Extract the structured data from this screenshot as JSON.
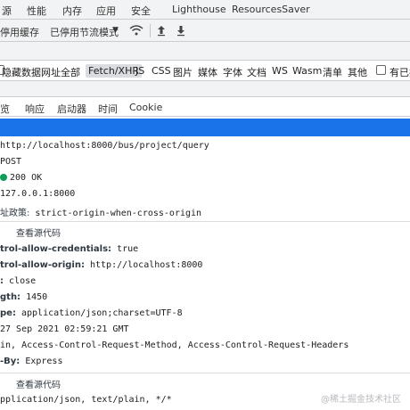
{
  "top_tabs": [
    "源",
    "性能",
    "内存",
    "应用",
    "安全",
    "Lighthouse",
    "ResourcesSaver"
  ],
  "toolbar": {
    "disable_cache": "停用缓存",
    "throttle": "已停用节流模式",
    "throttle_arrow": "▼"
  },
  "filters": {
    "hide_data_urls": "隐藏数据网址",
    "all": "全部",
    "types": [
      "Fetch/XHR",
      "JS",
      "CSS",
      "图片",
      "媒体",
      "字体",
      "文档",
      "WS",
      "Wasm",
      "清单",
      "其他"
    ],
    "blocked_label": "有已拦"
  },
  "detail_tabs": [
    "览",
    "响应",
    "启动器",
    "时间",
    "Cookie"
  ],
  "general": {
    "url": "http://localhost:8000/bus/project/query",
    "method": "POST",
    "status": "200 OK",
    "remote": "127.0.0.1:8000",
    "referrer_key": "址政策:",
    "referrer_value": "strict-origin-when-cross-origin"
  },
  "section_header_1": "查看源代码",
  "response_headers": [
    {
      "k": "trol-allow-credentials:",
      "v": "true"
    },
    {
      "k": "trol-allow-origin:",
      "v": "http://localhost:8000"
    },
    {
      "k": ":",
      "v": "close"
    },
    {
      "k": "gth:",
      "v": "1450"
    },
    {
      "k": "pe:",
      "v": "application/json;charset=UTF-8"
    },
    {
      "k": "",
      "v": "27 Sep 2021 02:59:21 GMT"
    },
    {
      "k": "",
      "v": "in, Access-Control-Request-Method, Access-Control-Request-Headers"
    },
    {
      "k": "-By:",
      "v": "Express"
    }
  ],
  "section_header_2": "查看源代码",
  "request_accept": "pplication/json, text/plain, */*",
  "watermark": "@稀土掘金技术社区"
}
